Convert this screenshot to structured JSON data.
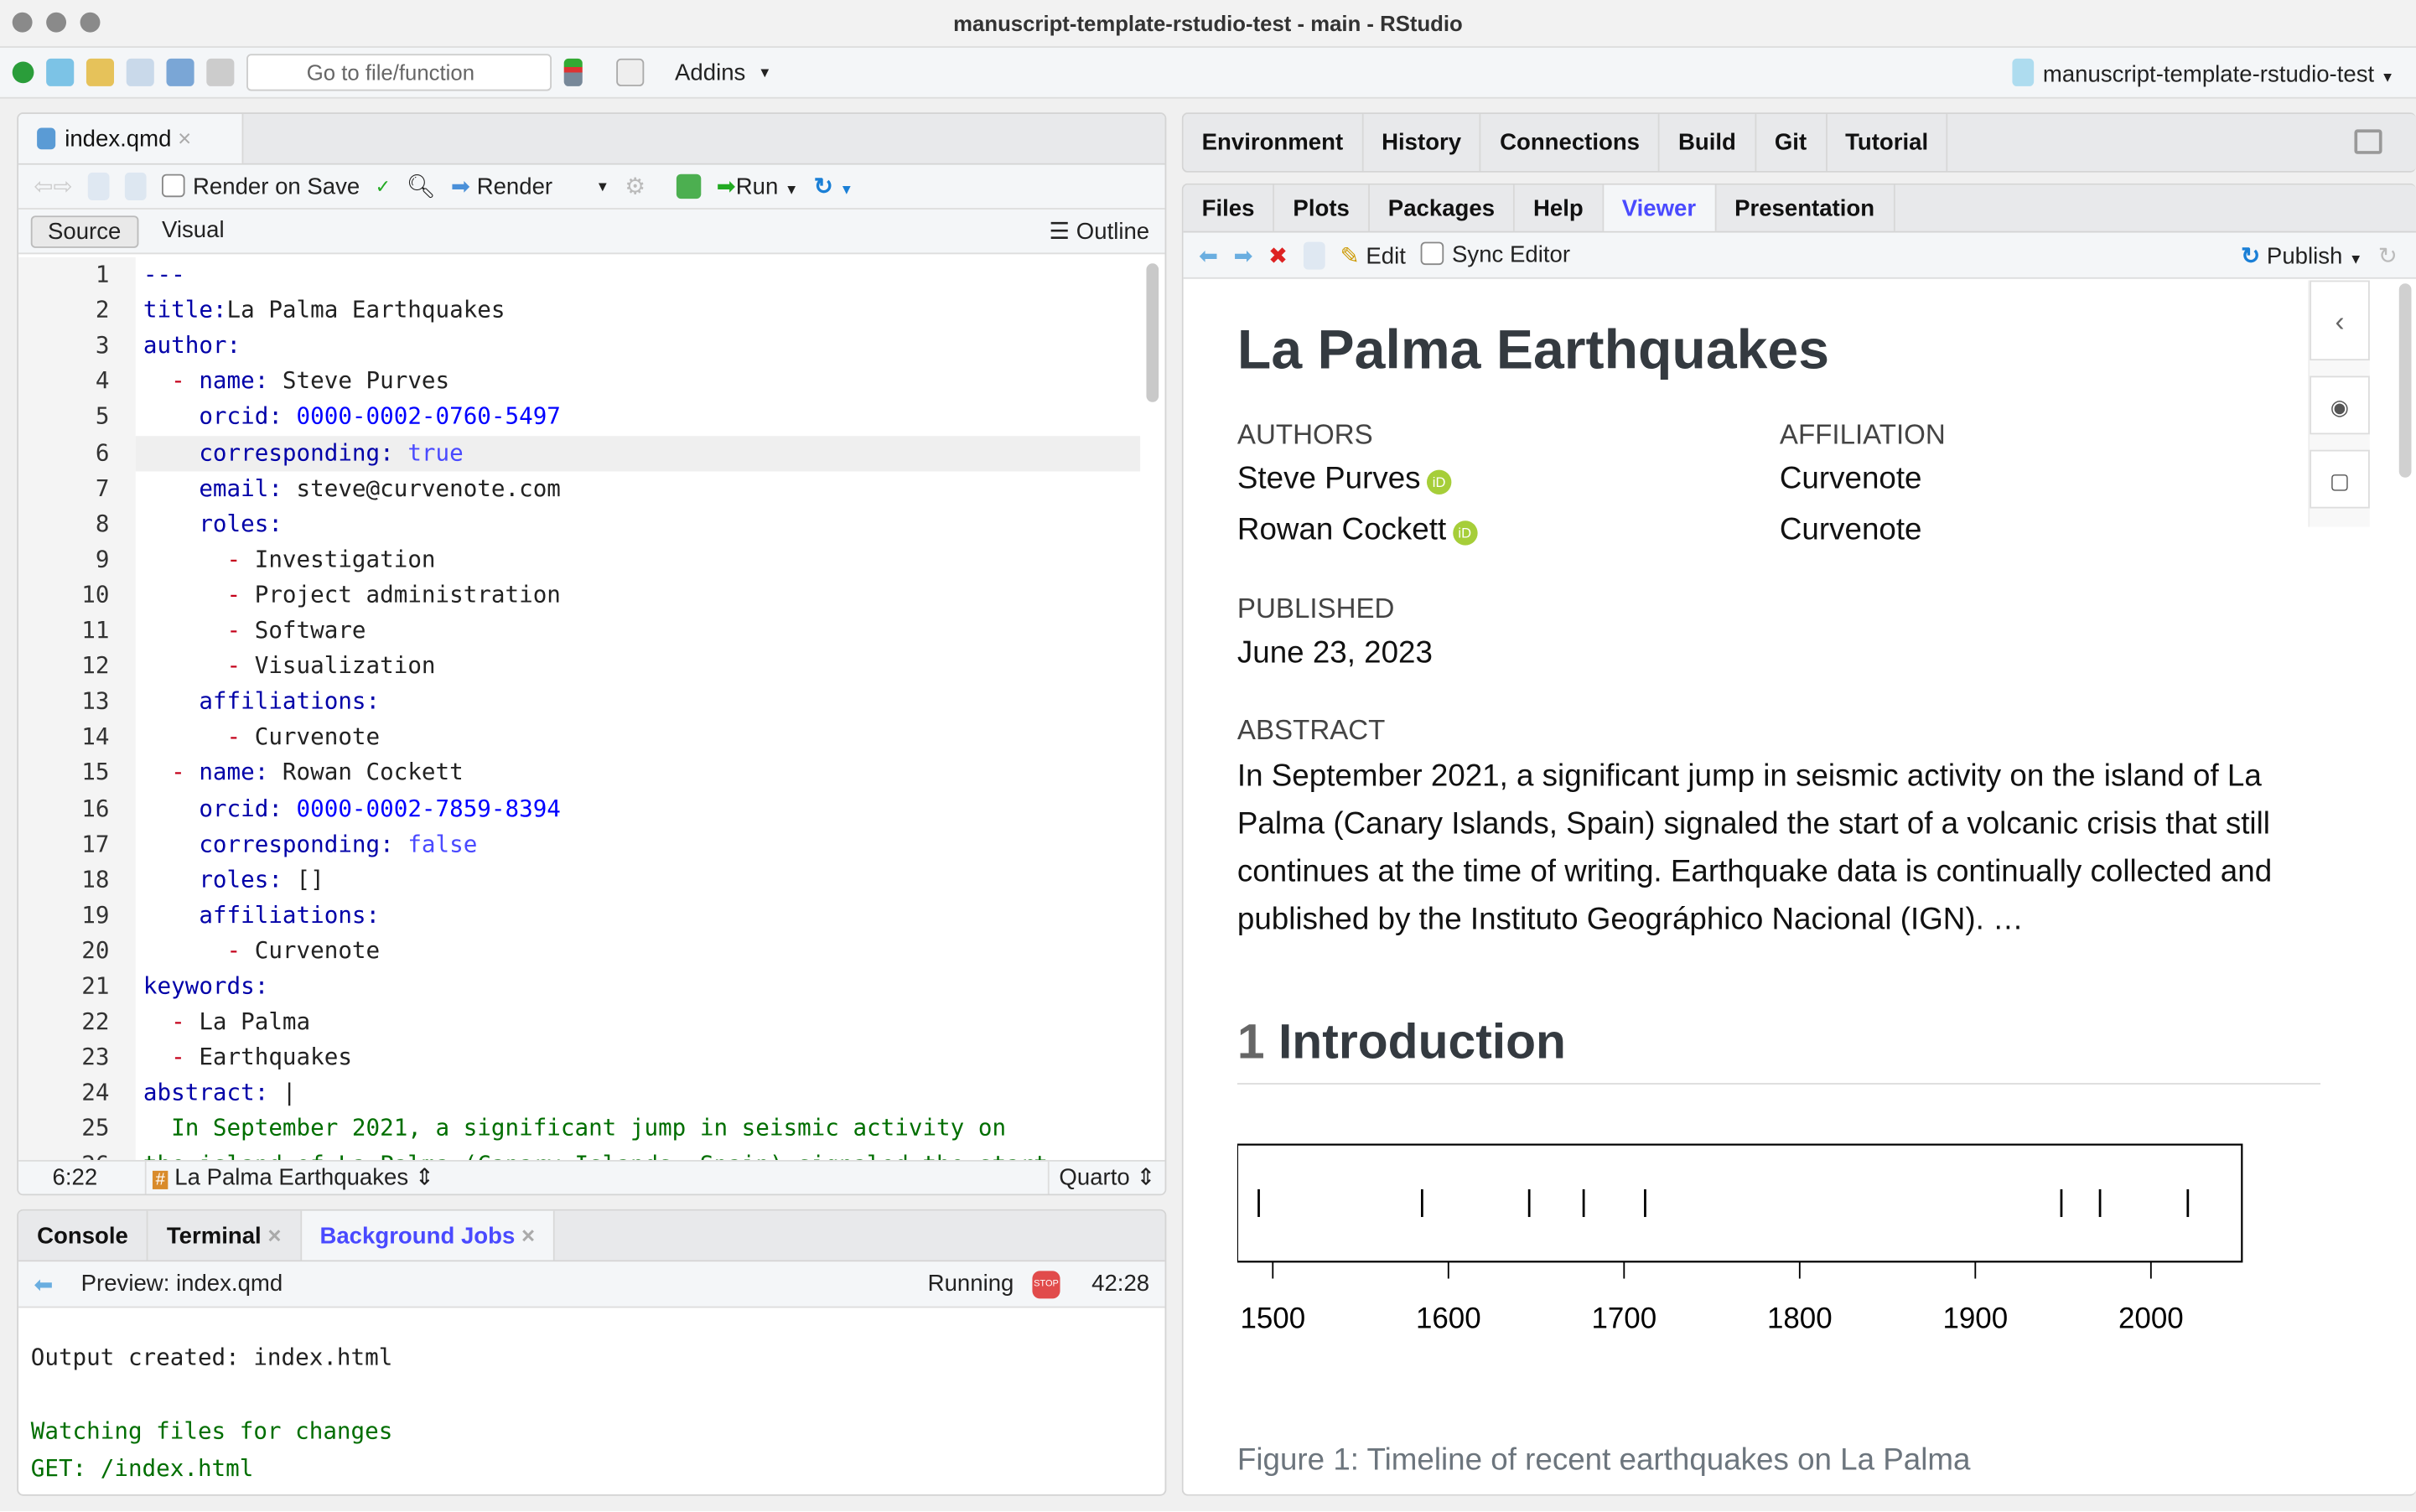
{
  "window": {
    "title": "manuscript-template-rstudio-test - main - RStudio"
  },
  "toolbar": {
    "goto_placeholder": "Go to file/function",
    "addins": "Addins",
    "project": "manuscript-template-rstudio-test"
  },
  "editor": {
    "tab": "index.qmd",
    "render_on_save": "Render on Save",
    "render": "Render",
    "run": "Run",
    "source": "Source",
    "visual": "Visual",
    "outline": "Outline",
    "lines": [
      [
        [
          "k",
          "---"
        ]
      ],
      [
        [
          "k",
          "title:"
        ],
        [
          "",
          "La Palma Earthquakes"
        ]
      ],
      [
        [
          "k",
          "author:"
        ]
      ],
      [
        [
          "",
          "  "
        ],
        [
          "d",
          "-"
        ],
        [
          "k",
          " name:"
        ],
        [
          "",
          " Steve Purves"
        ]
      ],
      [
        [
          "k",
          "    orcid:"
        ],
        [
          "n",
          " 0000-0002-0760-5497"
        ]
      ],
      [
        [
          "k",
          "    corresponding:"
        ],
        [
          "b",
          " true"
        ]
      ],
      [
        [
          "k",
          "    email:"
        ],
        [
          "",
          " steve@curvenote.com"
        ]
      ],
      [
        [
          "k",
          "    roles:"
        ]
      ],
      [
        [
          "",
          "      "
        ],
        [
          "d",
          "-"
        ],
        [
          "",
          " Investigation"
        ]
      ],
      [
        [
          "",
          "      "
        ],
        [
          "d",
          "-"
        ],
        [
          "",
          " Project administration"
        ]
      ],
      [
        [
          "",
          "      "
        ],
        [
          "d",
          "-"
        ],
        [
          "",
          " Software"
        ]
      ],
      [
        [
          "",
          "      "
        ],
        [
          "d",
          "-"
        ],
        [
          "",
          " Visualization"
        ]
      ],
      [
        [
          "k",
          "    affiliations:"
        ]
      ],
      [
        [
          "",
          "      "
        ],
        [
          "d",
          "-"
        ],
        [
          "",
          " Curvenote"
        ]
      ],
      [
        [
          "",
          "  "
        ],
        [
          "d",
          "-"
        ],
        [
          "k",
          " name:"
        ],
        [
          "",
          " Rowan Cockett"
        ]
      ],
      [
        [
          "k",
          "    orcid:"
        ],
        [
          "n",
          " 0000-0002-7859-8394"
        ]
      ],
      [
        [
          "k",
          "    corresponding:"
        ],
        [
          "b",
          " false"
        ]
      ],
      [
        [
          "k",
          "    roles:"
        ],
        [
          "",
          " []"
        ]
      ],
      [
        [
          "k",
          "    affiliations:"
        ]
      ],
      [
        [
          "",
          "      "
        ],
        [
          "d",
          "-"
        ],
        [
          "",
          " Curvenote"
        ]
      ],
      [
        [
          "k",
          "keywords:"
        ]
      ],
      [
        [
          "",
          "  "
        ],
        [
          "d",
          "-"
        ],
        [
          "",
          " La Palma"
        ]
      ],
      [
        [
          "",
          "  "
        ],
        [
          "d",
          "-"
        ],
        [
          "",
          " Earthquakes"
        ]
      ],
      [
        [
          "k",
          "abstract:"
        ],
        [
          "",
          " |"
        ]
      ],
      [
        [
          "g",
          "  In September 2021, a significant jump in seismic activity on"
        ]
      ],
      [
        [
          "g",
          "the island of La Palma (Canary Islands, Spain) signaled the start"
        ]
      ]
    ],
    "cursor": "6:22",
    "section": "La Palma Earthquakes",
    "filetype": "Quarto"
  },
  "console": {
    "tabs": [
      "Console",
      "Terminal",
      "Background Jobs"
    ],
    "job": "Preview: index.qmd",
    "status": "Running",
    "time": "42:28",
    "output": [
      [
        "",
        "Output created: index.html"
      ],
      [
        "",
        ""
      ],
      [
        "g",
        "Watching files for changes"
      ],
      [
        "g",
        "GET: /index.html"
      ]
    ]
  },
  "upper_right": {
    "tabs": [
      "Environment",
      "History",
      "Connections",
      "Build",
      "Git",
      "Tutorial"
    ]
  },
  "lower_right": {
    "tabs": [
      "Files",
      "Plots",
      "Packages",
      "Help",
      "Viewer",
      "Presentation"
    ],
    "edit": "Edit",
    "sync": "Sync Editor",
    "publish": "Publish"
  },
  "viewer": {
    "title": "La Palma Earthquakes",
    "authors_label": "AUTHORS",
    "affiliation_label": "AFFILIATION",
    "authors": [
      {
        "name": "Steve Purves",
        "affiliation": "Curvenote"
      },
      {
        "name": "Rowan Cockett",
        "affiliation": "Curvenote"
      }
    ],
    "published_label": "PUBLISHED",
    "published": "June 23, 2023",
    "abstract_label": "ABSTRACT",
    "abstract": "In September 2021, a significant jump in seismic activity on the island of La Palma (Canary Islands, Spain) signaled the start of a volcanic crisis that still continues at the time of writing. Earthquake data is continually collected and published by the Instituto Geográphico Nacional (IGN). …",
    "section_num": "1",
    "section": "Introduction",
    "caption": "Figure 1: Timeline of recent earthquakes on La Palma"
  },
  "chart_data": {
    "type": "scatter",
    "x": [
      1492,
      1585,
      1646,
      1677,
      1712,
      1949,
      1971,
      2021
    ],
    "xlim": [
      1471,
      2043
    ],
    "ticks": [
      1500,
      1600,
      1700,
      1800,
      1900,
      2000
    ],
    "tick_labels": [
      "1500",
      "1600",
      "1700",
      "1800",
      "1900",
      "2000"
    ],
    "grid": false,
    "marker": "vertical-line"
  }
}
